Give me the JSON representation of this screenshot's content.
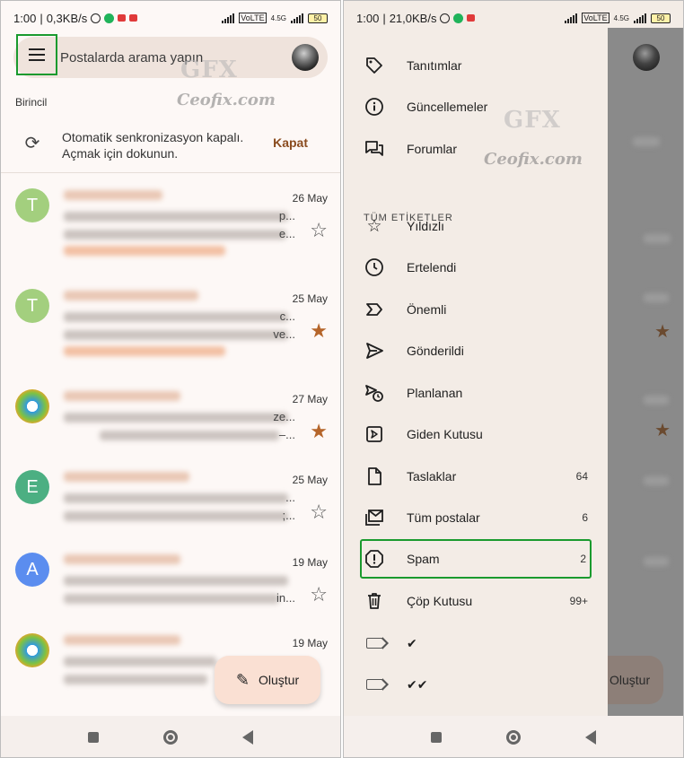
{
  "left": {
    "status": {
      "time": "1:00",
      "speed": "0,3KB/s",
      "volte": "VoLTE",
      "network": "4.5G",
      "battery": "50"
    },
    "search": {
      "placeholder": "Postalarda arama yapın",
      "menu_icon": "hamburger-menu-icon"
    },
    "watermark": {
      "logo": "GFX",
      "site": "Ceofix.com"
    },
    "section_label": "Birincil",
    "sync_banner": {
      "line1": "Otomatik senkronizasyon kapalı.",
      "line2": "Açmak için dokunun.",
      "action": "Kapat",
      "icon": "sync-icon"
    },
    "mails": [
      {
        "avatar": "T",
        "avatar_color": "#a3cf7e",
        "date": "26 May",
        "tail1": "p...",
        "tail2": "e...",
        "starred": false
      },
      {
        "avatar": "T",
        "avatar_color": "#a3cf7e",
        "date": "25 May",
        "tail1": "c...",
        "tail2": "ve...",
        "starred": true
      },
      {
        "avatar": "",
        "avatar_color": "windows",
        "date": "27 May",
        "tail1": "ze...",
        "tail2": "–...",
        "starred": true
      },
      {
        "avatar": "E",
        "avatar_color": "#4caf82",
        "date": "25 May",
        "tail1": "...",
        "tail2": ";...",
        "starred": false
      },
      {
        "avatar": "A",
        "avatar_color": "#5b8def",
        "date": "19 May",
        "tail1": "",
        "tail2": "in...",
        "starred": false
      },
      {
        "avatar": "",
        "avatar_color": "windows",
        "date": "19 May",
        "tail1": "fo",
        "tail2": "",
        "starred": false
      }
    ],
    "fab_label": "Oluştur",
    "colors": {
      "accent": "#8a4b1e",
      "star": "#b5652a",
      "highlight": "#1a9a2e"
    }
  },
  "right": {
    "status": {
      "time": "1:00",
      "speed": "21,0KB/s",
      "volte": "VoLTE",
      "network": "4.5G",
      "battery": "50"
    },
    "watermark": {
      "logo": "GFX",
      "site": "Ceofix.com"
    },
    "items_top": [
      {
        "label": "Tanıtımlar",
        "icon": "tag-icon"
      },
      {
        "label": "Güncellemeler",
        "icon": "info-icon"
      },
      {
        "label": "Forumlar",
        "icon": "forum-icon"
      }
    ],
    "section_label": "TÜM ETİKETLER",
    "labels": [
      {
        "label": "Yıldızlı",
        "count": "",
        "icon": "star-icon"
      },
      {
        "label": "Ertelendi",
        "count": "",
        "icon": "clock-icon"
      },
      {
        "label": "Önemli",
        "count": "",
        "icon": "important-icon"
      },
      {
        "label": "Gönderildi",
        "count": "",
        "icon": "send-icon"
      },
      {
        "label": "Planlanan",
        "count": "",
        "icon": "schedule-send-icon"
      },
      {
        "label": "Giden Kutusu",
        "count": "",
        "icon": "outbox-icon"
      },
      {
        "label": "Taslaklar",
        "count": "64",
        "icon": "draft-icon"
      },
      {
        "label": "Tüm postalar",
        "count": "6",
        "icon": "all-mail-icon"
      },
      {
        "label": "Spam",
        "count": "2",
        "icon": "spam-icon"
      },
      {
        "label": "Çöp Kutusu",
        "count": "99+",
        "icon": "trash-icon"
      },
      {
        "label": "✔",
        "count": "",
        "icon": "label-icon"
      },
      {
        "label": "✔✔",
        "count": "",
        "icon": "label-icon"
      }
    ],
    "fab_label": "Oluştur"
  }
}
